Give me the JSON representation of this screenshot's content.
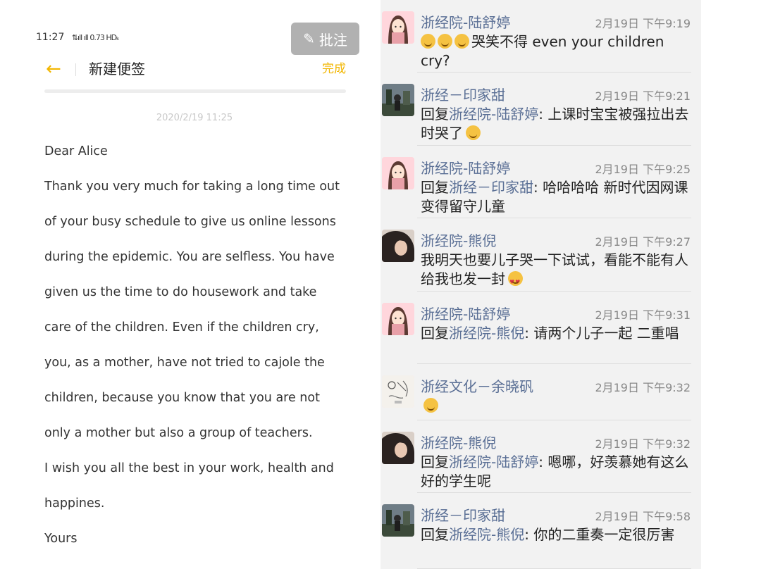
{
  "note_app": {
    "status_time": "11:27",
    "status_signal": "⇅ıll ıll 0.73 HDₖ",
    "annotate_label": "批注",
    "toolbar_title": "新建便签",
    "done_label": "完成",
    "date": "2020/2/19 11:25",
    "lines": [
      "Dear Alice",
      "Thank you very much for taking a long time out",
      "of your busy schedule to give us online lessons",
      "during the epidemic. You are selfless. You have",
      "given us the time to do housework and take",
      "care of the children. Even if the children cry,",
      "you, as a mother, have not tried to cajole the",
      "children, because you know that you are not",
      "only a mother but also a group of teachers.",
      "I wish you all the best in your work, health and",
      "happines.",
      "Yours"
    ]
  },
  "chat": {
    "messages": [
      {
        "sender": "浙经院-陆舒婷",
        "time": "2月19日 下午9:19",
        "avatar": "cartoon-girl",
        "reply_prefix": "",
        "reply_to": "",
        "text": "哭笑不得 even your children cry?",
        "lead_emoji": 3
      },
      {
        "sender": "浙经－印家甜",
        "time": "2月19日 下午9:21",
        "avatar": "photo-outdoor",
        "reply_prefix": "回复",
        "reply_to": "浙经院-陆舒婷",
        "text": ": 上课时宝宝被强拉出去时哭了"
      },
      {
        "sender": "浙经院-陆舒婷",
        "time": "2月19日 下午9:25",
        "avatar": "cartoon-girl",
        "reply_prefix": "回复",
        "reply_to": "浙经－印家甜",
        "text": ": 哈哈哈哈 新时代因网课变得留守儿童"
      },
      {
        "sender": "浙经院-熊倪",
        "time": "2月19日 下午9:27",
        "avatar": "photo-portrait",
        "reply_prefix": "",
        "reply_to": "",
        "text": "我明天也要儿子哭一下试试，看能不能有人给我也发一封"
      },
      {
        "sender": "浙经院-陆舒婷",
        "time": "2月19日 下午9:31",
        "avatar": "cartoon-girl",
        "reply_prefix": "回复",
        "reply_to": "浙经院-熊倪",
        "text": ": 请两个儿子一起 二重唱"
      },
      {
        "sender": "浙经文化－余晓矾",
        "time": "2月19日 下午9:32",
        "avatar": "sketch",
        "reply_prefix": "",
        "reply_to": "",
        "text": ""
      },
      {
        "sender": "浙经院-熊倪",
        "time": "2月19日 下午9:32",
        "avatar": "photo-portrait",
        "reply_prefix": "回复",
        "reply_to": "浙经院-陆舒婷",
        "text": ": 嗯哪，好羡慕她有这么好的学生呢"
      },
      {
        "sender": "浙经－印家甜",
        "time": "2月19日 下午9:58",
        "avatar": "photo-outdoor",
        "reply_prefix": "回复",
        "reply_to": "浙经院-熊倪",
        "text": ": 你的二重奏一定很厉害"
      }
    ]
  },
  "colors": {
    "accent_yellow": "#f2b600",
    "chat_name_blue": "#5a6f95"
  }
}
